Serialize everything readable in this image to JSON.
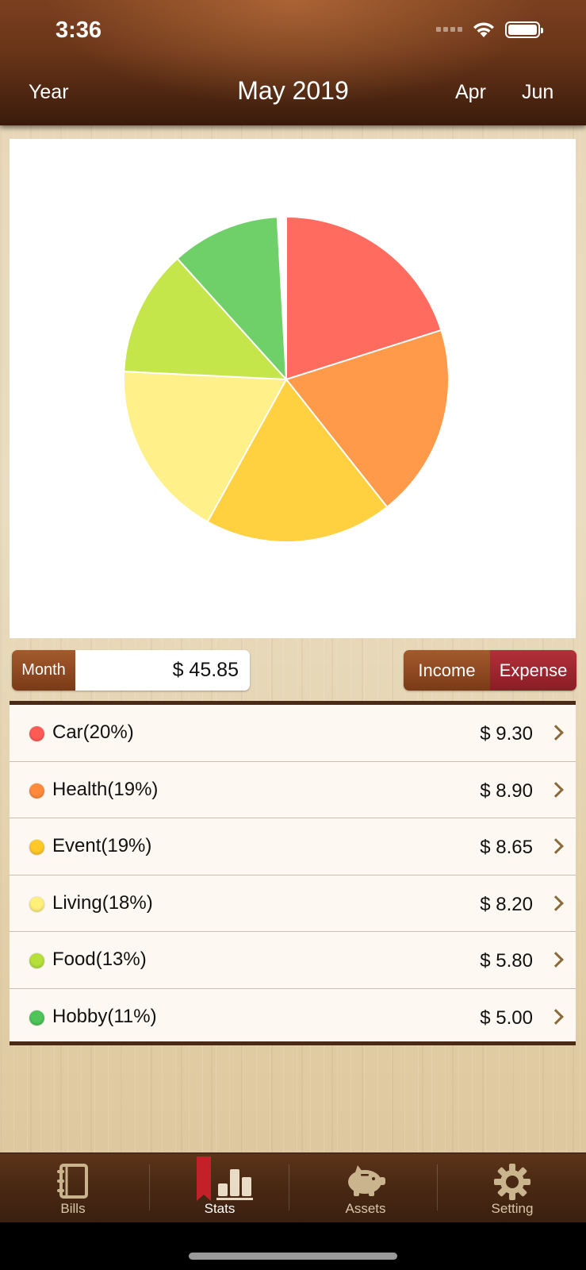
{
  "status": {
    "time": "3:36"
  },
  "nav": {
    "year": "Year",
    "title": "May 2019",
    "prev": "Apr",
    "next": "Jun"
  },
  "summary": {
    "period_label": "Month",
    "total": "$ 45.85"
  },
  "toggle": {
    "income": "Income",
    "expense": "Expense",
    "selected": "Expense"
  },
  "chart_data": {
    "type": "pie",
    "categories": [
      "Car",
      "Health",
      "Event",
      "Living",
      "Food",
      "Hobby"
    ],
    "values": [
      9.3,
      8.9,
      8.65,
      8.2,
      5.8,
      5.0
    ],
    "colors": [
      "#ff6b5e",
      "#ff9a4a",
      "#ffd040",
      "#fff08a",
      "#c4e64a",
      "#6fd06a"
    ]
  },
  "items": [
    {
      "label": "Car(20%)",
      "amount": "$ 9.30",
      "color": "#ff5b55"
    },
    {
      "label": "Health(19%)",
      "amount": "$ 8.90",
      "color": "#ff8a3c"
    },
    {
      "label": "Event(19%)",
      "amount": "$ 8.65",
      "color": "#ffc928"
    },
    {
      "label": "Living(18%)",
      "amount": "$ 8.20",
      "color": "#fff07a"
    },
    {
      "label": "Food(13%)",
      "amount": "$ 5.80",
      "color": "#b5e03a"
    },
    {
      "label": "Hobby(11%)",
      "amount": "$ 5.00",
      "color": "#4ec45a"
    }
  ],
  "tabs": [
    {
      "label": "Bills",
      "icon": "notebook-icon"
    },
    {
      "label": "Stats",
      "icon": "bar-chart-icon",
      "active": true
    },
    {
      "label": "Assets",
      "icon": "piggy-bank-icon"
    },
    {
      "label": "Setting",
      "icon": "gear-icon"
    }
  ]
}
